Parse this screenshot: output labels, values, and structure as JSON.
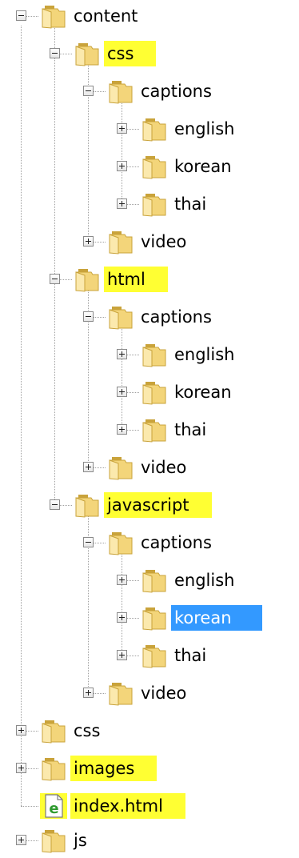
{
  "tree": {
    "nodes": [
      {
        "label": "content",
        "icon": "folder-icon",
        "expanded": true,
        "highlighted": false,
        "selected": false
      },
      {
        "label": "css",
        "icon": "folder-icon",
        "expanded": true,
        "highlighted": true,
        "selected": false
      },
      {
        "label": "captions",
        "icon": "folder-icon",
        "expanded": true,
        "highlighted": false,
        "selected": false
      },
      {
        "label": "english",
        "icon": "folder-icon",
        "expanded": false,
        "highlighted": false,
        "selected": false
      },
      {
        "label": "korean",
        "icon": "folder-icon",
        "expanded": false,
        "highlighted": false,
        "selected": false
      },
      {
        "label": "thai",
        "icon": "folder-icon",
        "expanded": false,
        "highlighted": false,
        "selected": false
      },
      {
        "label": "video",
        "icon": "folder-icon",
        "expanded": false,
        "highlighted": false,
        "selected": false
      },
      {
        "label": "html",
        "icon": "folder-icon",
        "expanded": true,
        "highlighted": true,
        "selected": false
      },
      {
        "label": "captions",
        "icon": "folder-icon",
        "expanded": true,
        "highlighted": false,
        "selected": false
      },
      {
        "label": "english",
        "icon": "folder-icon",
        "expanded": false,
        "highlighted": false,
        "selected": false
      },
      {
        "label": "korean",
        "icon": "folder-icon",
        "expanded": false,
        "highlighted": false,
        "selected": false
      },
      {
        "label": "thai",
        "icon": "folder-icon",
        "expanded": false,
        "highlighted": false,
        "selected": false
      },
      {
        "label": "video",
        "icon": "folder-icon",
        "expanded": false,
        "highlighted": false,
        "selected": false
      },
      {
        "label": "javascript",
        "icon": "folder-icon",
        "expanded": true,
        "highlighted": true,
        "selected": false
      },
      {
        "label": "captions",
        "icon": "folder-icon",
        "expanded": true,
        "highlighted": false,
        "selected": false
      },
      {
        "label": "english",
        "icon": "folder-icon",
        "expanded": false,
        "highlighted": false,
        "selected": false
      },
      {
        "label": "korean",
        "icon": "folder-icon",
        "expanded": false,
        "highlighted": false,
        "selected": true
      },
      {
        "label": "thai",
        "icon": "folder-icon",
        "expanded": false,
        "highlighted": false,
        "selected": false
      },
      {
        "label": "video",
        "icon": "folder-icon",
        "expanded": false,
        "highlighted": false,
        "selected": false
      },
      {
        "label": "css",
        "icon": "folder-icon",
        "expanded": false,
        "highlighted": false,
        "selected": false
      },
      {
        "label": "images",
        "icon": "folder-icon",
        "expanded": false,
        "highlighted": true,
        "selected": false
      },
      {
        "label": "index.html",
        "icon": "html-file-icon",
        "expanded": null,
        "highlighted": true,
        "selected": false
      },
      {
        "label": "js",
        "icon": "folder-icon",
        "expanded": false,
        "highlighted": false,
        "selected": false
      }
    ]
  },
  "colors": {
    "highlight": "#ffff33",
    "selection": "#3399ff",
    "selection_text": "#ffffff",
    "folder": "#f3d57a",
    "folder_dark": "#c9a33b",
    "file_icon_green": "#2e9a2e"
  }
}
